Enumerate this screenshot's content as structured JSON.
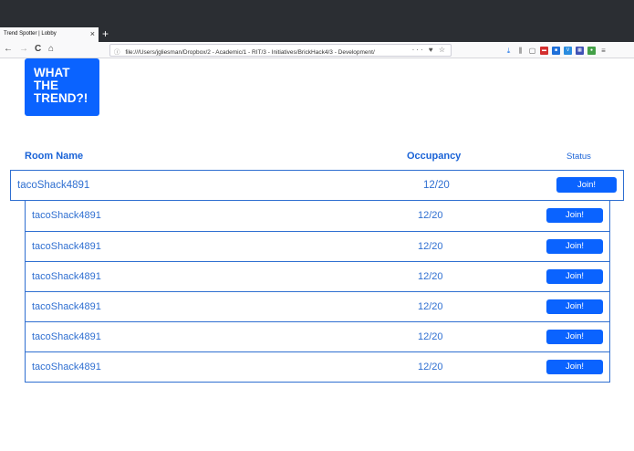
{
  "browser": {
    "tab_title": "Trend Spotter | Lobby",
    "tab_close": "×",
    "new_tab": "+",
    "url": "file:///Users/jgliesman/Dropbox/2 - Academic/1 - RIT/3 - Initiatives/BrickHack4/3 - Development/",
    "url_actions": "··· ♥ ☆",
    "nav": {
      "back": "←",
      "forward": "→",
      "reload": "C",
      "home": "⌂",
      "info": "ⓘ"
    }
  },
  "logo": {
    "line1": "WHAT",
    "line2": "THE",
    "line3": "TREND?!"
  },
  "table": {
    "headers": {
      "room": "Room Name",
      "occupancy": "Occupancy",
      "status": "Status"
    },
    "featured": {
      "name": "tacoShack4891",
      "occupancy": "12/20",
      "action": "Join!"
    },
    "rows": [
      {
        "name": "tacoShack4891",
        "occupancy": "12/20",
        "action": "Join!"
      },
      {
        "name": "tacoShack4891",
        "occupancy": "12/20",
        "action": "Join!"
      },
      {
        "name": "tacoShack4891",
        "occupancy": "12/20",
        "action": "Join!"
      },
      {
        "name": "tacoShack4891",
        "occupancy": "12/20",
        "action": "Join!"
      },
      {
        "name": "tacoShack4891",
        "occupancy": "12/20",
        "action": "Join!"
      },
      {
        "name": "tacoShack4891",
        "occupancy": "12/20",
        "action": "Join!"
      }
    ]
  },
  "colors": {
    "accent": "#0a63ff",
    "text_blue": "#2f6fd1",
    "chrome_dark": "#2b2e33"
  }
}
